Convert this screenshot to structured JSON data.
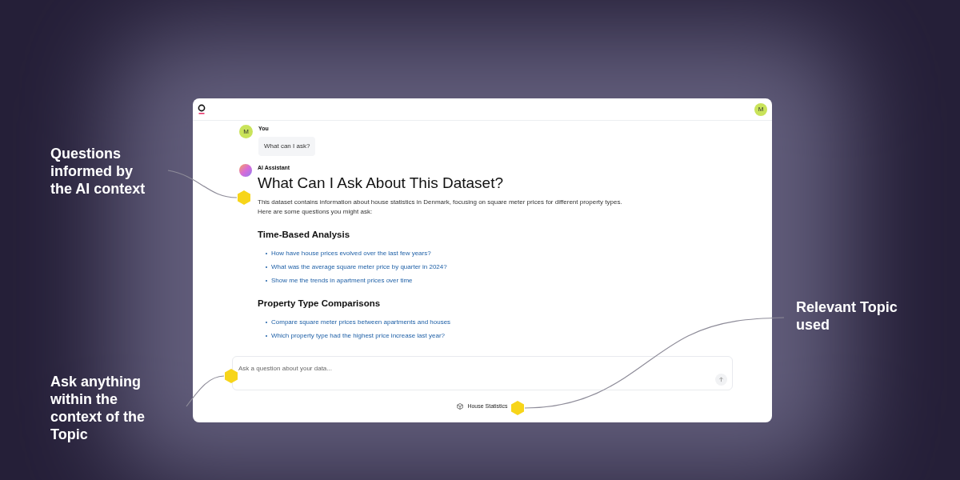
{
  "header": {
    "avatar": "M"
  },
  "messages": [
    {
      "kind": "user",
      "avatar": "M",
      "author": "You",
      "text": "What can I ask?"
    },
    {
      "kind": "assistant",
      "author": "AI Assistant",
      "title": "What Can I Ask About This Dataset?",
      "intro": "This dataset contains information about house statistics in Denmark, focusing on square meter prices for different property types. Here are some questions you might ask:",
      "sections": [
        {
          "heading": "Time-Based Analysis",
          "questions": [
            "How have house prices evolved over the last few years?",
            "What was the average square meter price by quarter in 2024?",
            "Show me the trends in apartment prices over time"
          ]
        },
        {
          "heading": "Property Type Comparisons",
          "questions": [
            "Compare square meter prices between apartments and houses",
            "Which property type had the highest price increase last year?"
          ]
        }
      ]
    }
  ],
  "composer": {
    "placeholder": "Ask a question about your data..."
  },
  "topic": {
    "label": "House Statistics"
  },
  "callouts": [
    {
      "text": "Questions informed by the AI context"
    },
    {
      "text": "Ask anything within the context of the Topic"
    },
    {
      "text": "Relevant Topic used"
    }
  ]
}
